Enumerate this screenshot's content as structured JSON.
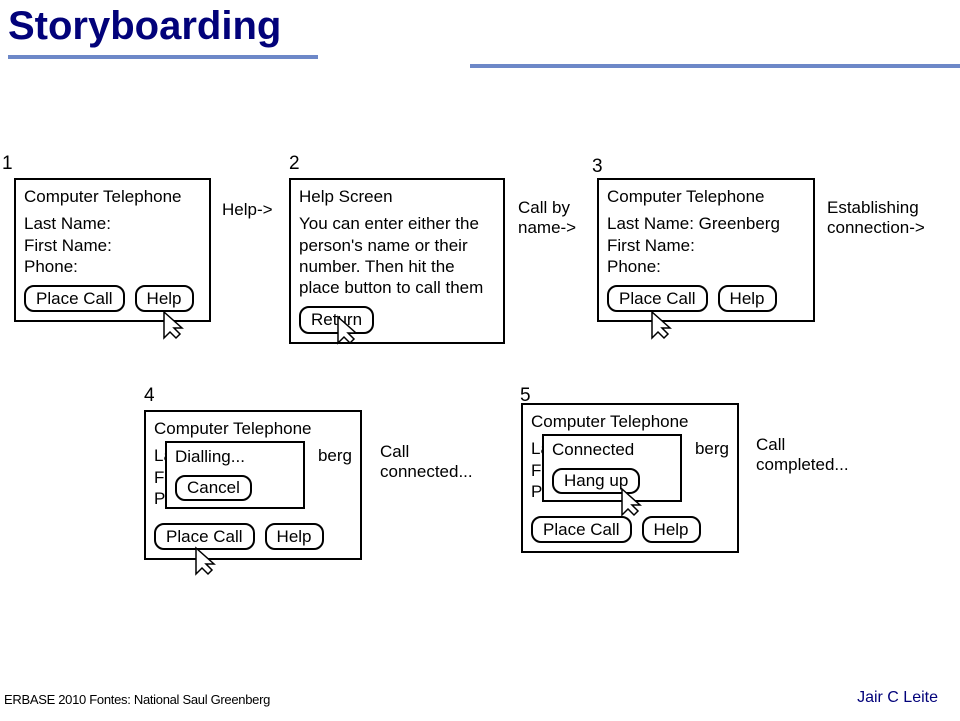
{
  "title": "Storyboarding",
  "footer_left": "ERBASE 2010   Fontes: National Saul Greenberg",
  "footer_right": "Jair C Leite",
  "nums": {
    "n1": "1",
    "n2": "2",
    "n3": "3",
    "n4": "4",
    "n5": "5"
  },
  "annots": {
    "a1": "Help->",
    "a2": "Call by\nname->",
    "a3": "Establishing\nconnection->",
    "a4": "Call\nconnected...",
    "a5": "Call\ncompleted..."
  },
  "panel1": {
    "title": "Computer Telephone",
    "line1": "Last Name:",
    "line2": "First Name:",
    "line3": "Phone:",
    "btn1": "Place Call",
    "btn2": "Help"
  },
  "panel2": {
    "title": "Help Screen",
    "body": "You can enter either the person's name or their number. Then hit the place button to call them",
    "btn1": "Return"
  },
  "panel3": {
    "title": "Computer Telephone",
    "line1": "Last Name: Greenberg",
    "line2": "First Name:",
    "line3": "Phone:",
    "btn1": "Place Call",
    "btn2": "Help"
  },
  "panel4": {
    "title": "Computer Telephone",
    "bg_line1_left": "La",
    "bg_line1_right": "berg",
    "bg_line2": "F",
    "bg_line3": "Ph",
    "dialog_title": "Dialling...",
    "dialog_btn": "Cancel",
    "btn1": "Place Call",
    "btn2": "Help"
  },
  "panel5": {
    "title": "Computer Telephone",
    "bg_line1_left": "La",
    "bg_line1_right": "berg",
    "bg_line2": "F",
    "bg_line3": "Ph",
    "dialog_title": "Connected",
    "dialog_btn": "Hang up",
    "btn1": "Place Call",
    "btn2": "Help"
  }
}
